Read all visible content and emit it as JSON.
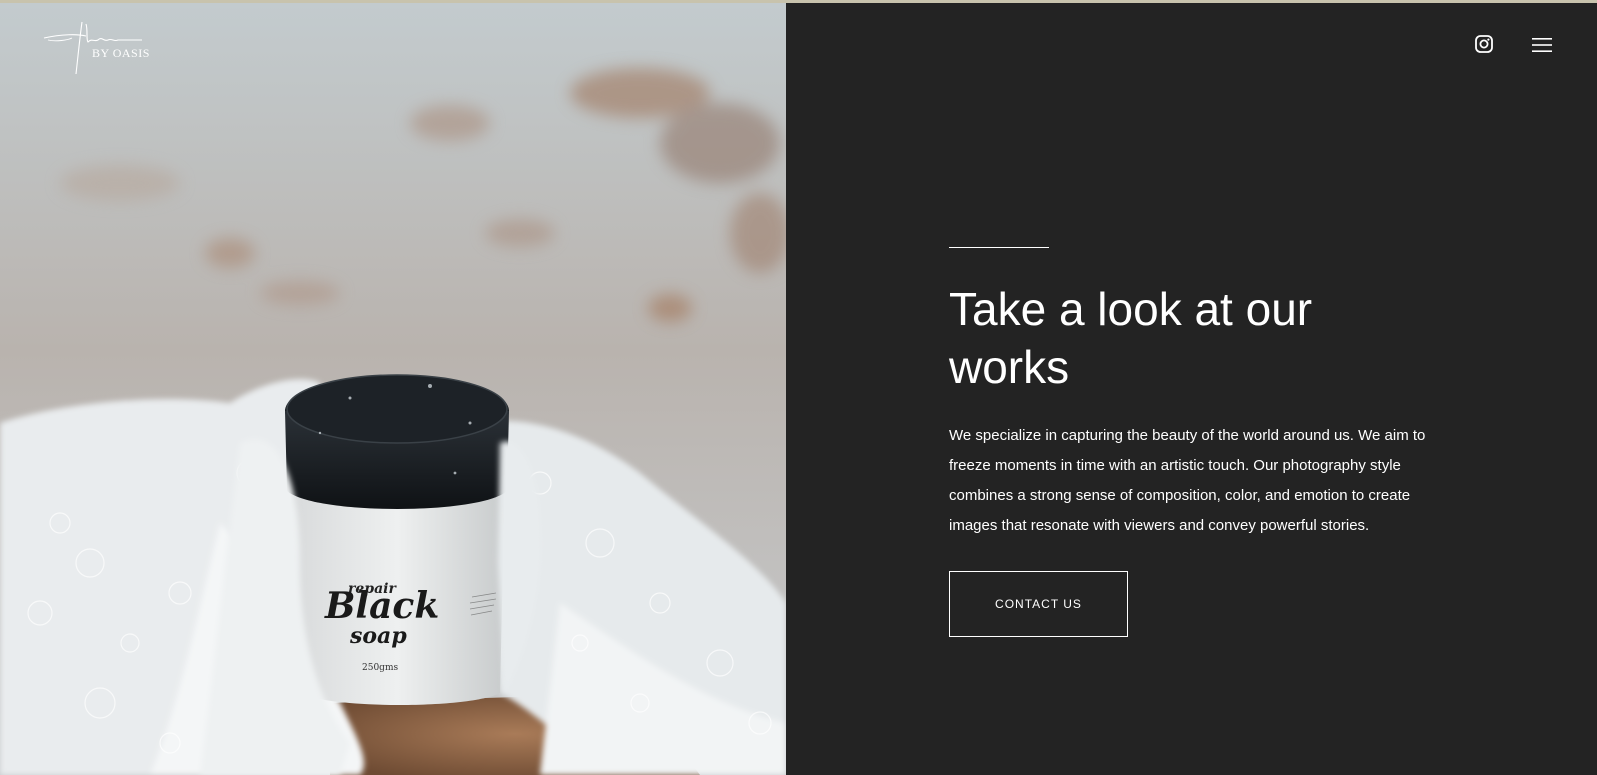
{
  "brand": {
    "logo_text": "By oasis",
    "logo_signature": "Jillian"
  },
  "header": {
    "instagram_icon": "instagram-icon",
    "menu_icon": "hamburger-menu-icon"
  },
  "hero": {
    "title": "Take a look at our works",
    "description": "We specialize in capturing the beauty of the world around us. We aim to freeze moments in time with an artistic touch. Our photography style combines a strong sense of composition, color, and emotion to create images that resonate with viewers and convey powerful stories.",
    "cta_label": "CONTACT US"
  },
  "product_photo": {
    "jar_label_line1": "repair",
    "jar_label_line2": "Black",
    "jar_label_line3": "soap",
    "jar_weight": "250gms"
  },
  "colors": {
    "panel": "#232323",
    "text": "#ffffff"
  }
}
